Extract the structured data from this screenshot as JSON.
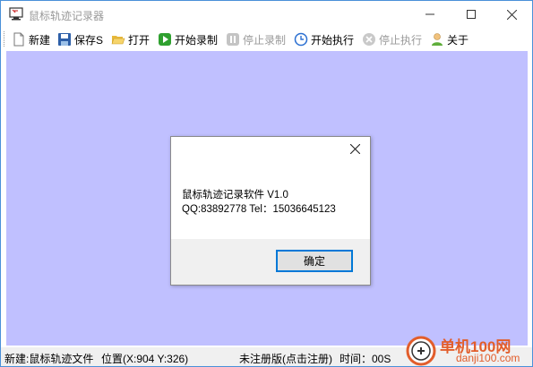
{
  "window": {
    "title": "鼠标轨迹记录器"
  },
  "toolbar": {
    "new": "新建",
    "save": "保存S",
    "open": "打开",
    "start_record": "开始录制",
    "stop_record": "停止录制",
    "start_exec": "开始执行",
    "stop_exec": "停止执行",
    "about": "关于"
  },
  "dialog": {
    "line1": "鼠标轨迹记录软件 V1.0",
    "line2": "QQ:83892778   Tel：15036645123",
    "ok": "确定"
  },
  "statusbar": {
    "file": "新建:鼠标轨迹文件",
    "position": "位置(X:904 Y:326)",
    "register": "未注册版(点击注册)",
    "time": "时间：00S"
  },
  "watermark": {
    "cn": "单机100网",
    "en": "danji100.com"
  },
  "colors": {
    "canvas": "#c0c0ff",
    "accent": "#0078d7",
    "watermark": "#e25d2b"
  }
}
